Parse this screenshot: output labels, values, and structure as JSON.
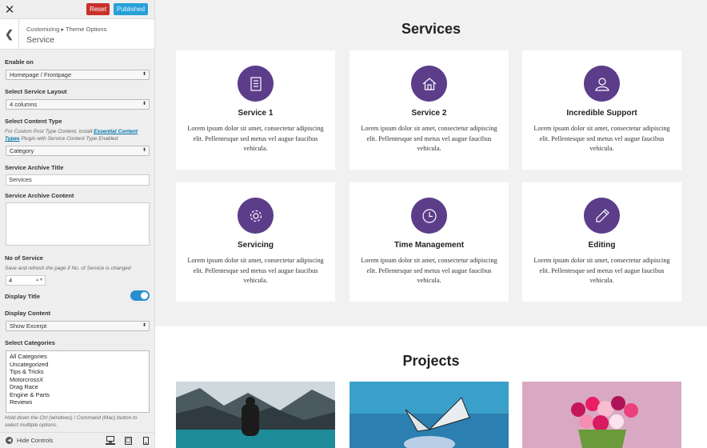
{
  "panel": {
    "close_glyph": "✕",
    "reset_label": "Reset",
    "published_label": "Published",
    "breadcrumb": "Customizing ▸ Theme Options",
    "section_title": "Service",
    "enable_on": {
      "label": "Enable on",
      "value": "Homepage / Frontpage"
    },
    "layout": {
      "label": "Select Service Layout",
      "value": "4 columns"
    },
    "content_type": {
      "label": "Select Content Type",
      "note_prefix": "For Custom Post Type Content, install",
      "note_link": "Essential Content Types",
      "note_suffix": "Plugin with Service Content Type Enabled",
      "value": "Category"
    },
    "archive_title": {
      "label": "Service Archive Title",
      "value": "Services"
    },
    "archive_content": {
      "label": "Service Archive Content"
    },
    "no_of_service": {
      "label": "No of Service",
      "note": "Save and refresh the page if No. of Service is changed",
      "value": "4"
    },
    "display_title": {
      "label": "Display Title",
      "on": true
    },
    "display_content": {
      "label": "Display Content",
      "value": "Show Excerpt"
    },
    "categories": {
      "label": "Select Categories",
      "options": [
        "All Categories",
        "Uncategorized",
        "Tips & Tricks",
        "MotorcrossX",
        "Drag Race",
        "Engine & Parts",
        "Reviews"
      ],
      "note": "Hold down the Ctrl (windows) / Command (Mac) button to select multiple options."
    },
    "footer": {
      "hide_controls": "Hide Controls"
    }
  },
  "preview": {
    "services_heading": "Services",
    "services": [
      {
        "icon": "checklist-icon",
        "title": "Service 1",
        "text": "Lorem ipsum dolor sit amet, consectetur adipiscing elit. Pellentesque sed metus vel augue faucibus vehicula."
      },
      {
        "icon": "house-icon",
        "title": "Service 2",
        "text": "Lorem ipsum dolor sit amet, consectetur adipiscing elit. Pellentesque sed metus vel augue faucibus vehicula."
      },
      {
        "icon": "user-icon",
        "title": "Incredible Support",
        "text": "Lorem ipsum dolor sit amet, consectetur adipiscing elit. Pellentesque sed metus vel augue faucibus vehicula."
      },
      {
        "icon": "gear-icon",
        "title": "Servicing",
        "text": "Lorem ipsum dolor sit amet, consectetur adipiscing elit. Pellentesque sed metus vel augue faucibus vehicula."
      },
      {
        "icon": "clock-icon",
        "title": "Time Management",
        "text": "Lorem ipsum dolor sit amet, consectetur adipiscing elit. Pellentesque sed metus vel augue faucibus vehicula."
      },
      {
        "icon": "pencil-icon",
        "title": "Editing",
        "text": "Lorem ipsum dolor sit amet, consectetur adipiscing elit. Pellentesque sed metus vel augue faucibus vehicula."
      }
    ],
    "projects_heading": "Projects",
    "colors": {
      "accent": "#5c3d8a",
      "reset": "#c9302c",
      "published": "#27a0d8",
      "toggle": "#2a8ecf"
    }
  }
}
